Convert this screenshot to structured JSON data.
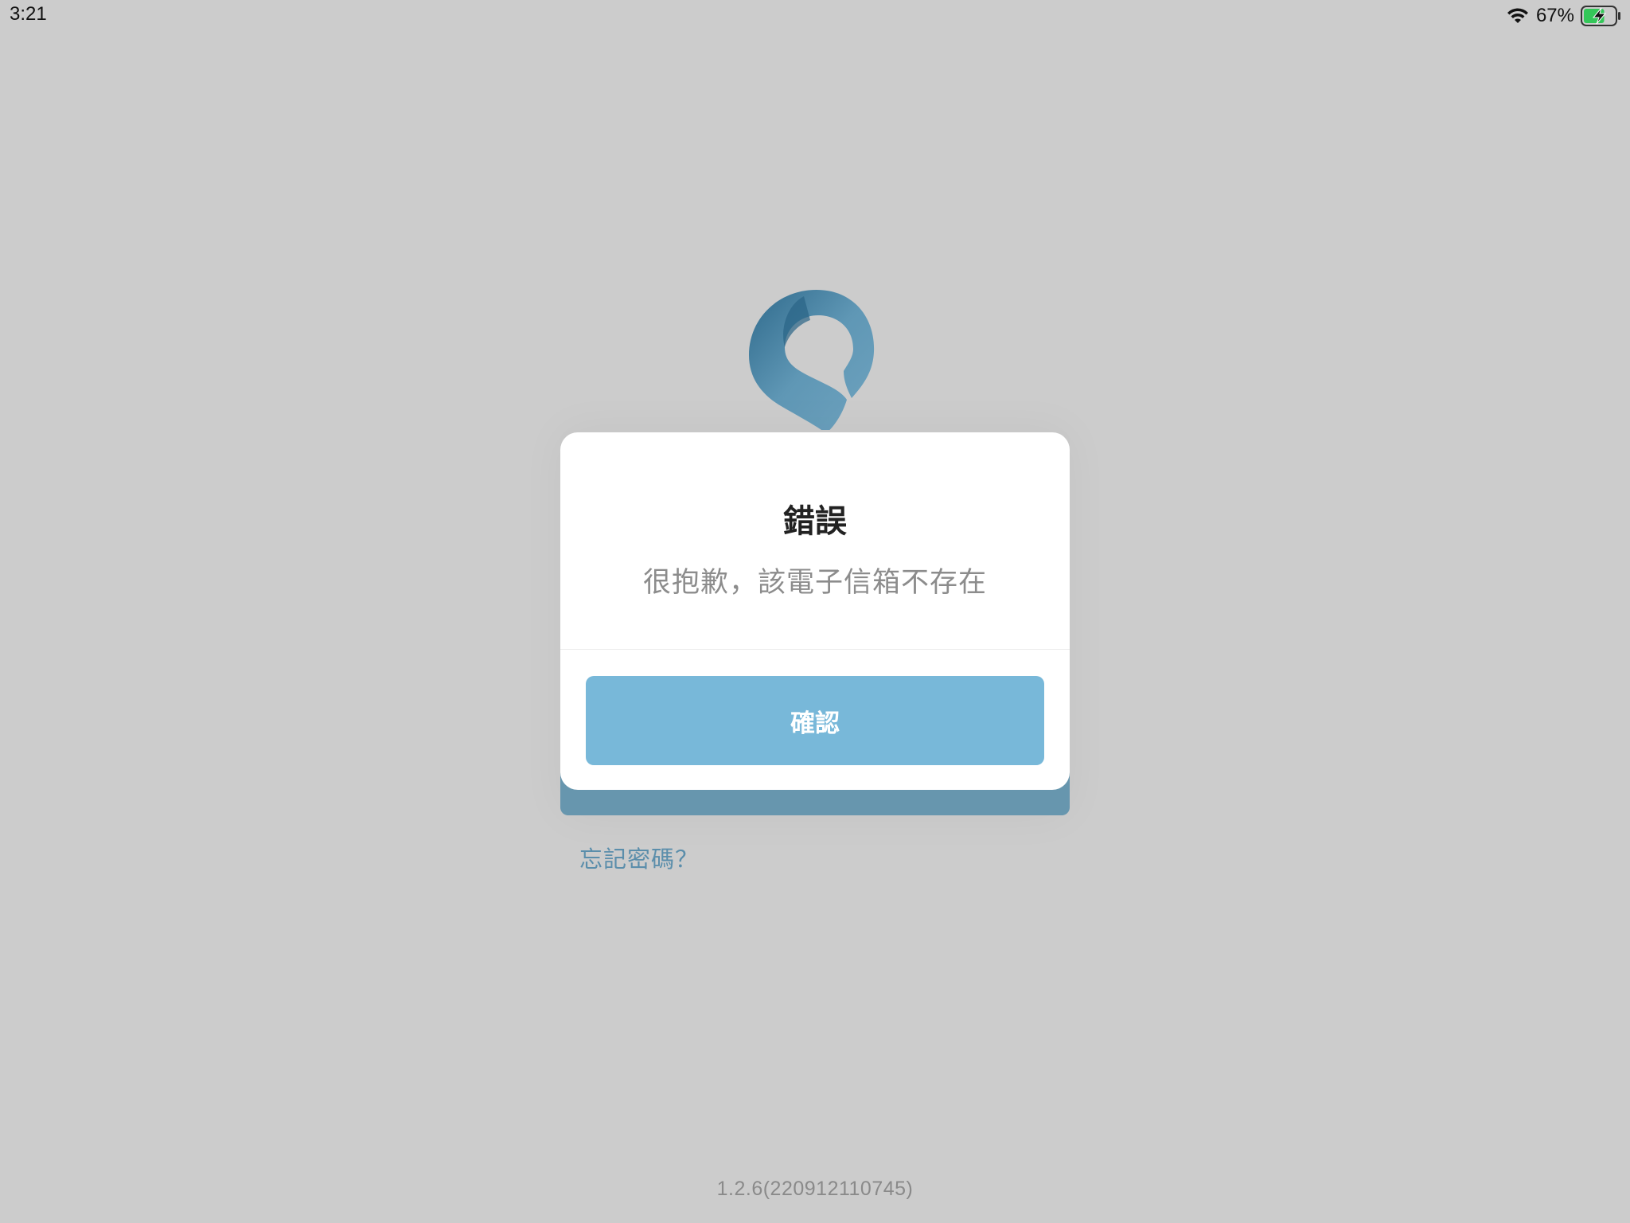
{
  "status_bar": {
    "time": "3:21",
    "battery_percent": "67%",
    "wifi_icon": "wifi-icon",
    "battery_icon": "battery-charging-icon",
    "battery_level": 0.67,
    "battery_color": "#34c759"
  },
  "brand": {
    "logo_icon": "brand-logo-icon",
    "accent_color": "#6796ae"
  },
  "dialog": {
    "title": "錯誤",
    "message": "很抱歉，該電子信箱不存在",
    "confirm_label": "確認",
    "confirm_color": "#78b8d9"
  },
  "login": {
    "forgot_password_label": "忘記密碼？"
  },
  "footer": {
    "version": "1.2.6(220912110745)"
  }
}
